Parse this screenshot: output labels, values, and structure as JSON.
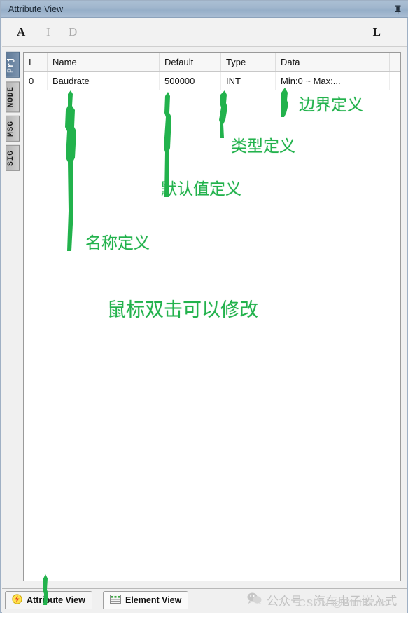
{
  "window": {
    "title": "Attribute View",
    "pin_icon": "pin-icon"
  },
  "toolbar": {
    "items": [
      {
        "label": "A",
        "name": "attribute-tool",
        "state": "active"
      },
      {
        "label": "I",
        "name": "import-tool",
        "state": "disabled"
      },
      {
        "label": "D",
        "name": "delete-tool",
        "state": "disabled"
      }
    ],
    "right_item": {
      "label": "L",
      "name": "layout-tool"
    }
  },
  "side_tabs": [
    {
      "label": "Prj",
      "selected": true
    },
    {
      "label": "NODE",
      "selected": false
    },
    {
      "label": "MSG",
      "selected": false
    },
    {
      "label": "SIG",
      "selected": false
    }
  ],
  "table": {
    "columns": [
      "I",
      "Name",
      "Default",
      "Type",
      "Data",
      ""
    ],
    "rows": [
      {
        "i": "0",
        "name": "Baudrate",
        "default": "500000",
        "type": "INT",
        "data": "Min:0 ~ Max:...",
        "extra": ""
      }
    ]
  },
  "annotations": {
    "name_def": "名称定义",
    "default_def": "默认值定义",
    "type_def": "类型定义",
    "boundary_def": "边界定义",
    "double_click_hint": "鼠标双击可以修改"
  },
  "bottom_tabs": [
    {
      "label": "Attribute View",
      "icon": "lightning-icon",
      "selected": true
    },
    {
      "label": "Element View",
      "icon": "list-icon",
      "selected": false
    }
  ],
  "watermarks": {
    "wechat": "公众号 · 汽车电子嵌入式",
    "csdn": "CSDN @PlutoZub"
  },
  "colors": {
    "titlebar": "#9fb5cc",
    "accent_green": "#22b24c",
    "selected_tab": "#5f7a98"
  }
}
